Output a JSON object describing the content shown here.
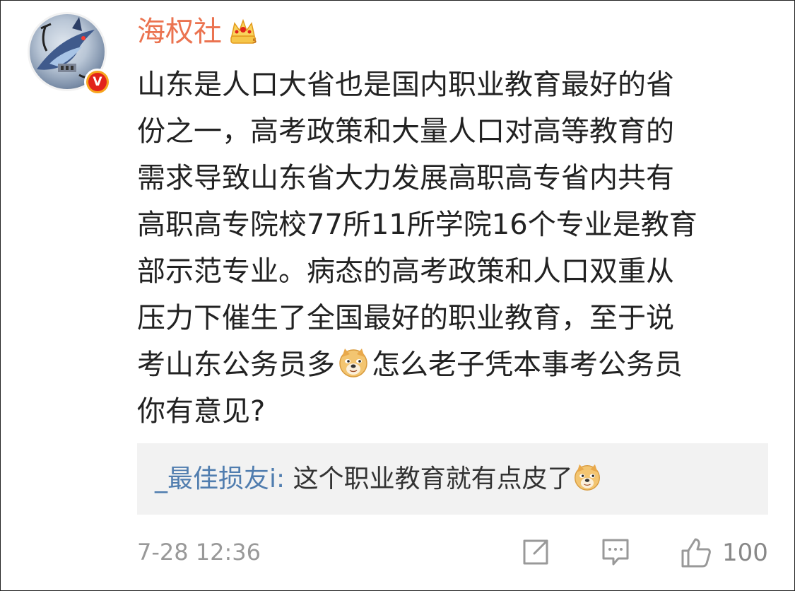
{
  "comment": {
    "username": "海权社",
    "badge_icon": "crown-vip-icon",
    "verified_icon": "verified-v-icon",
    "verified_letter": "V",
    "lines": [
      "山东是人口大省也是国内职业教育最好的省",
      "份之一，高考政策和大量人口对高等教育的",
      "需求导致山东省大力发展高职高专省内共有",
      "高职高专院校77所11所学院16个专业是教育",
      "部示范专业。病态的高考政策和人口双重从",
      "压力下催生了全国最好的职业教育，至于说"
    ],
    "line7_before": "考山东公务员多",
    "line7_after": "怎么老子凭本事考公务员",
    "line8": "你有意见?",
    "emoji": "doge-emoji"
  },
  "reply": {
    "username": "_最佳损友i:",
    "text": " 这个职业教育就有点皮了",
    "emoji": "doge-emoji"
  },
  "footer": {
    "timestamp": "7-28 12:36",
    "share_icon": "share-edit-icon",
    "comment_icon": "comment-icon",
    "like_icon": "thumbs-up-icon",
    "like_count": "100"
  },
  "colors": {
    "username": "#eb7350",
    "reply_username": "#507daf",
    "body_text": "#222222",
    "meta_text": "#999999",
    "reply_bg": "#f2f2f2"
  }
}
